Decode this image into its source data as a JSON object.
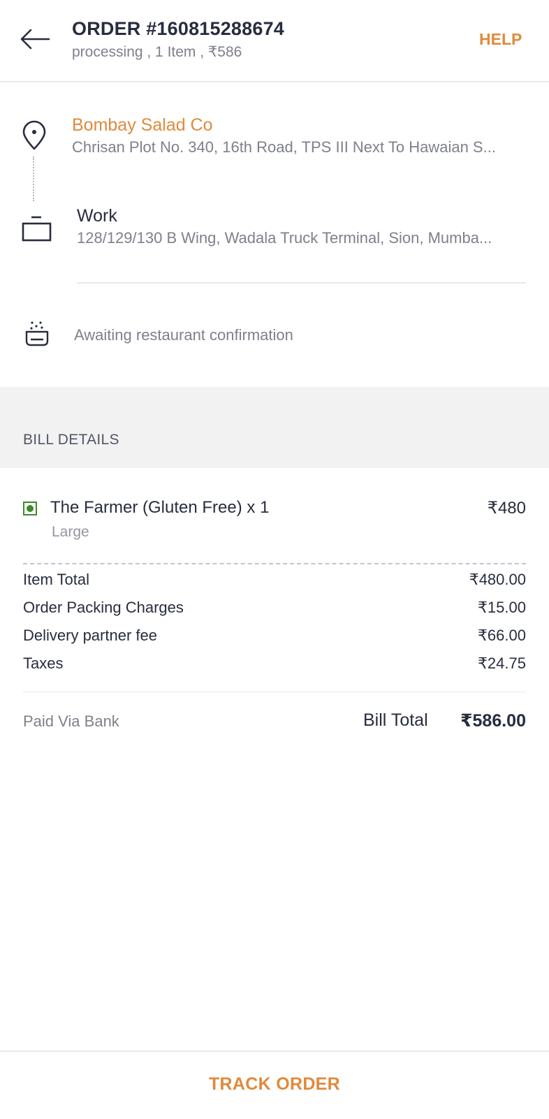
{
  "header": {
    "order_title": "ORDER #160815288674",
    "order_subtitle": "processing , 1 Item , ₹586",
    "help_label": "HELP"
  },
  "restaurant": {
    "name": "Bombay Salad Co",
    "address": "Chrisan Plot No. 340, 16th Road, TPS III Next To Hawaian S..."
  },
  "delivery": {
    "label": "Work",
    "address": "128/129/130 B Wing, Wadala Truck Terminal, Sion, Mumba..."
  },
  "status": {
    "text": "Awaiting restaurant confirmation"
  },
  "bill": {
    "section_title": "BILL DETAILS",
    "item": {
      "name": "The Farmer (Gluten Free) x 1",
      "variant": "Large",
      "price": "₹480",
      "veg": true
    },
    "rows": [
      {
        "label": "Item Total",
        "value": "₹480.00"
      },
      {
        "label": "Order Packing Charges",
        "value": "₹15.00"
      },
      {
        "label": "Delivery partner fee",
        "value": "₹66.00"
      },
      {
        "label": "Taxes",
        "value": "₹24.75"
      }
    ],
    "paid_via": "Paid Via Bank",
    "total_label": "Bill Total",
    "total_value": "₹586.00"
  },
  "footer": {
    "track_label": "TRACK ORDER"
  },
  "colors": {
    "accent": "#e08a3c",
    "veg": "#3d8a2a",
    "text_primary": "#282c3f",
    "text_secondary": "#7e808c"
  },
  "icons": {
    "back": "arrow-left-icon",
    "restaurant": "location-pin-icon",
    "delivery": "briefcase-icon",
    "status": "cooking-pot-icon",
    "veg": "veg-indicator-icon"
  }
}
